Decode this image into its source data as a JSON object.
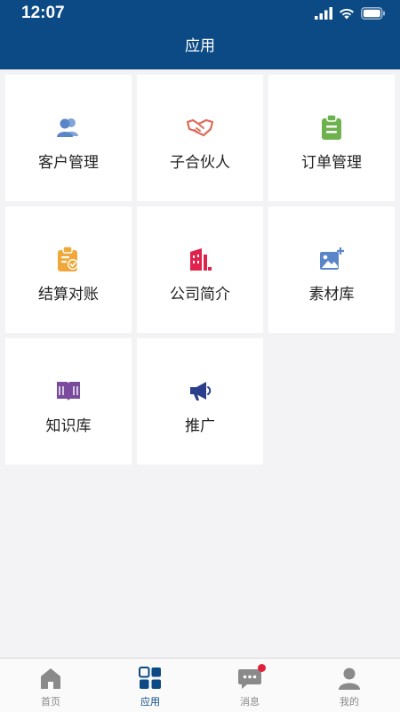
{
  "status": {
    "time": "12:07"
  },
  "header": {
    "title": "应用"
  },
  "apps": [
    {
      "label": "客户管理",
      "icon": "customers-icon",
      "color": "#5a86c9"
    },
    {
      "label": "子合伙人",
      "icon": "handshake-icon",
      "color": "#e06a5a"
    },
    {
      "label": "订单管理",
      "icon": "clipboard-icon",
      "color": "#6db24f"
    },
    {
      "label": "结算对账",
      "icon": "settlement-clipboard-icon",
      "color": "#f0a83a"
    },
    {
      "label": "公司简介",
      "icon": "building-icon",
      "color": "#e0224c"
    },
    {
      "label": "素材库",
      "icon": "image-add-icon",
      "color": "#5a86c9"
    },
    {
      "label": "知识库",
      "icon": "book-icon",
      "color": "#7a4a9c"
    },
    {
      "label": "推广",
      "icon": "megaphone-icon",
      "color": "#2b3e8c"
    }
  ],
  "tabs": [
    {
      "label": "首页",
      "icon": "home-icon"
    },
    {
      "label": "应用",
      "icon": "apps-grid-icon",
      "active": true
    },
    {
      "label": "消息",
      "icon": "message-icon",
      "badge": true
    },
    {
      "label": "我的",
      "icon": "user-icon"
    }
  ]
}
